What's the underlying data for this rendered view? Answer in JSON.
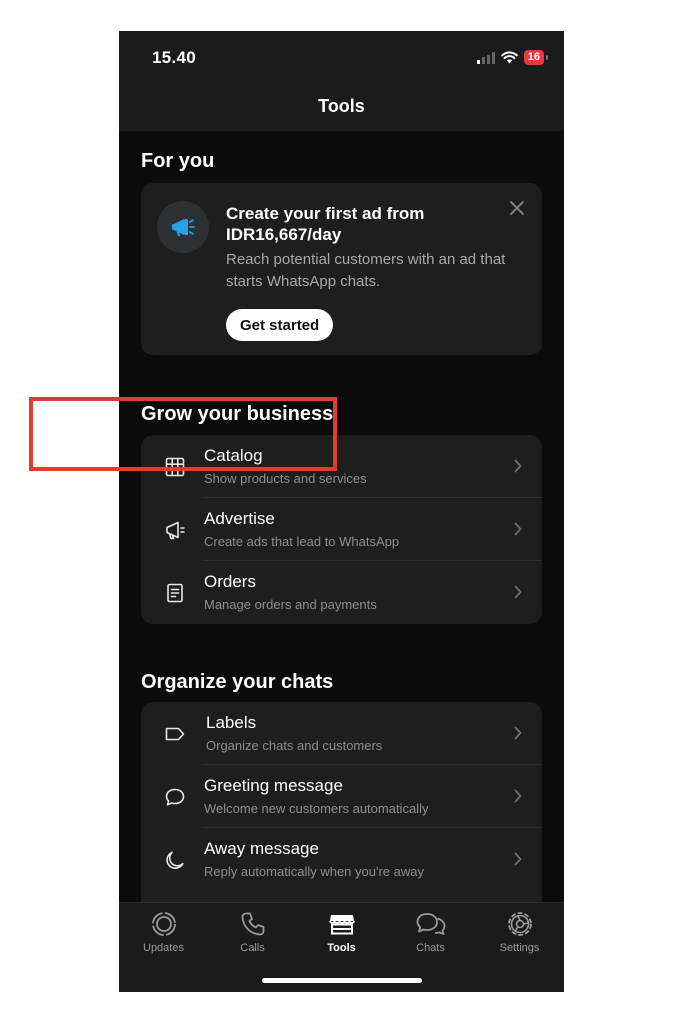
{
  "status_bar": {
    "time": "15.40",
    "battery": "16"
  },
  "header": {
    "title": "Tools"
  },
  "for_you": {
    "title": "For you",
    "promo": {
      "title": "Create your first ad from IDR16,667/day",
      "description": "Reach potential customers with an ad that starts WhatsApp chats.",
      "button_label": "Get started"
    }
  },
  "grow": {
    "title": "Grow your business",
    "items": [
      {
        "title": "Catalog",
        "subtitle": "Show products and services",
        "icon": "grid-icon"
      },
      {
        "title": "Advertise",
        "subtitle": "Create ads that lead to WhatsApp",
        "icon": "megaphone-icon"
      },
      {
        "title": "Orders",
        "subtitle": "Manage orders and payments",
        "icon": "receipt-icon"
      }
    ]
  },
  "organize": {
    "title": "Organize your chats",
    "items": [
      {
        "title": "Labels",
        "subtitle": "Organize chats and customers",
        "icon": "label-icon"
      },
      {
        "title": "Greeting message",
        "subtitle": "Welcome new customers automatically",
        "icon": "chat-bubble-icon"
      },
      {
        "title": "Away message",
        "subtitle": "Reply automatically when you're away",
        "icon": "moon-icon"
      }
    ]
  },
  "tabs": [
    {
      "label": "Updates",
      "icon": "updates-icon",
      "active": false
    },
    {
      "label": "Calls",
      "icon": "phone-icon",
      "active": false
    },
    {
      "label": "Tools",
      "icon": "store-icon",
      "active": true
    },
    {
      "label": "Chats",
      "icon": "chats-icon",
      "active": false
    },
    {
      "label": "Settings",
      "icon": "gear-icon",
      "active": false
    }
  ],
  "colors": {
    "background": "#0b0b0b",
    "card": "#1e1e1e",
    "highlight": "#e43a32",
    "accent": "#25a3e8"
  }
}
